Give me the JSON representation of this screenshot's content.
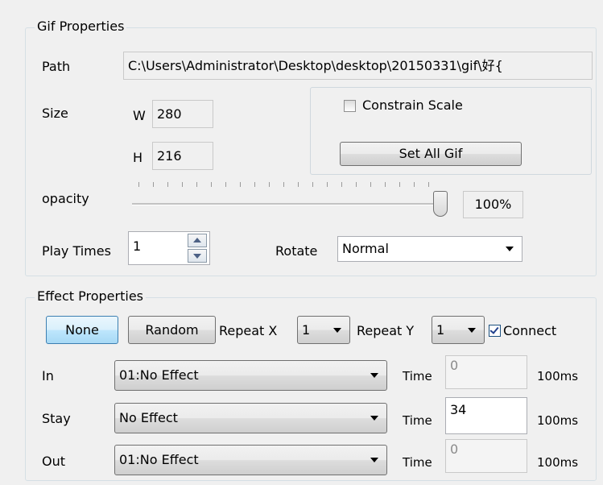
{
  "gif_properties": {
    "legend": "Gif Properties",
    "path_label": "Path",
    "path_value": "C:\\Users\\Administrator\\Desktop\\desktop\\20150331\\gif\\好{",
    "size_label": "Size",
    "width_label": "W",
    "width_value": "280",
    "height_label": "H",
    "height_value": "216",
    "constrain_scale_label": "Constrain Scale",
    "constrain_scale_checked": false,
    "set_all_gif_label": "Set All Gif",
    "opacity_label": "opacity",
    "opacity_value_text": "100%",
    "opacity_level": 1.0,
    "play_times_label": "Play Times",
    "play_times_value": "1",
    "rotate_label": "Rotate",
    "rotate_value": "Normal"
  },
  "effect_properties": {
    "legend": "Effect Properties",
    "none_label": "None",
    "random_label": "Random",
    "repeat_x_label": "Repeat X",
    "repeat_x_value": "1",
    "repeat_y_label": "Repeat Y",
    "repeat_y_value": "1",
    "connect_label": "Connect",
    "connect_checked": true,
    "rows": [
      {
        "label": "In",
        "effect": "01:No Effect",
        "time_label": "Time",
        "time_value": "0",
        "unit": "100ms"
      },
      {
        "label": "Stay",
        "effect": "No Effect",
        "time_label": "Time",
        "time_value": "34",
        "unit": "100ms"
      },
      {
        "label": "Out",
        "effect": "01:No Effect",
        "time_label": "Time",
        "time_value": "0",
        "unit": "100ms"
      }
    ]
  }
}
